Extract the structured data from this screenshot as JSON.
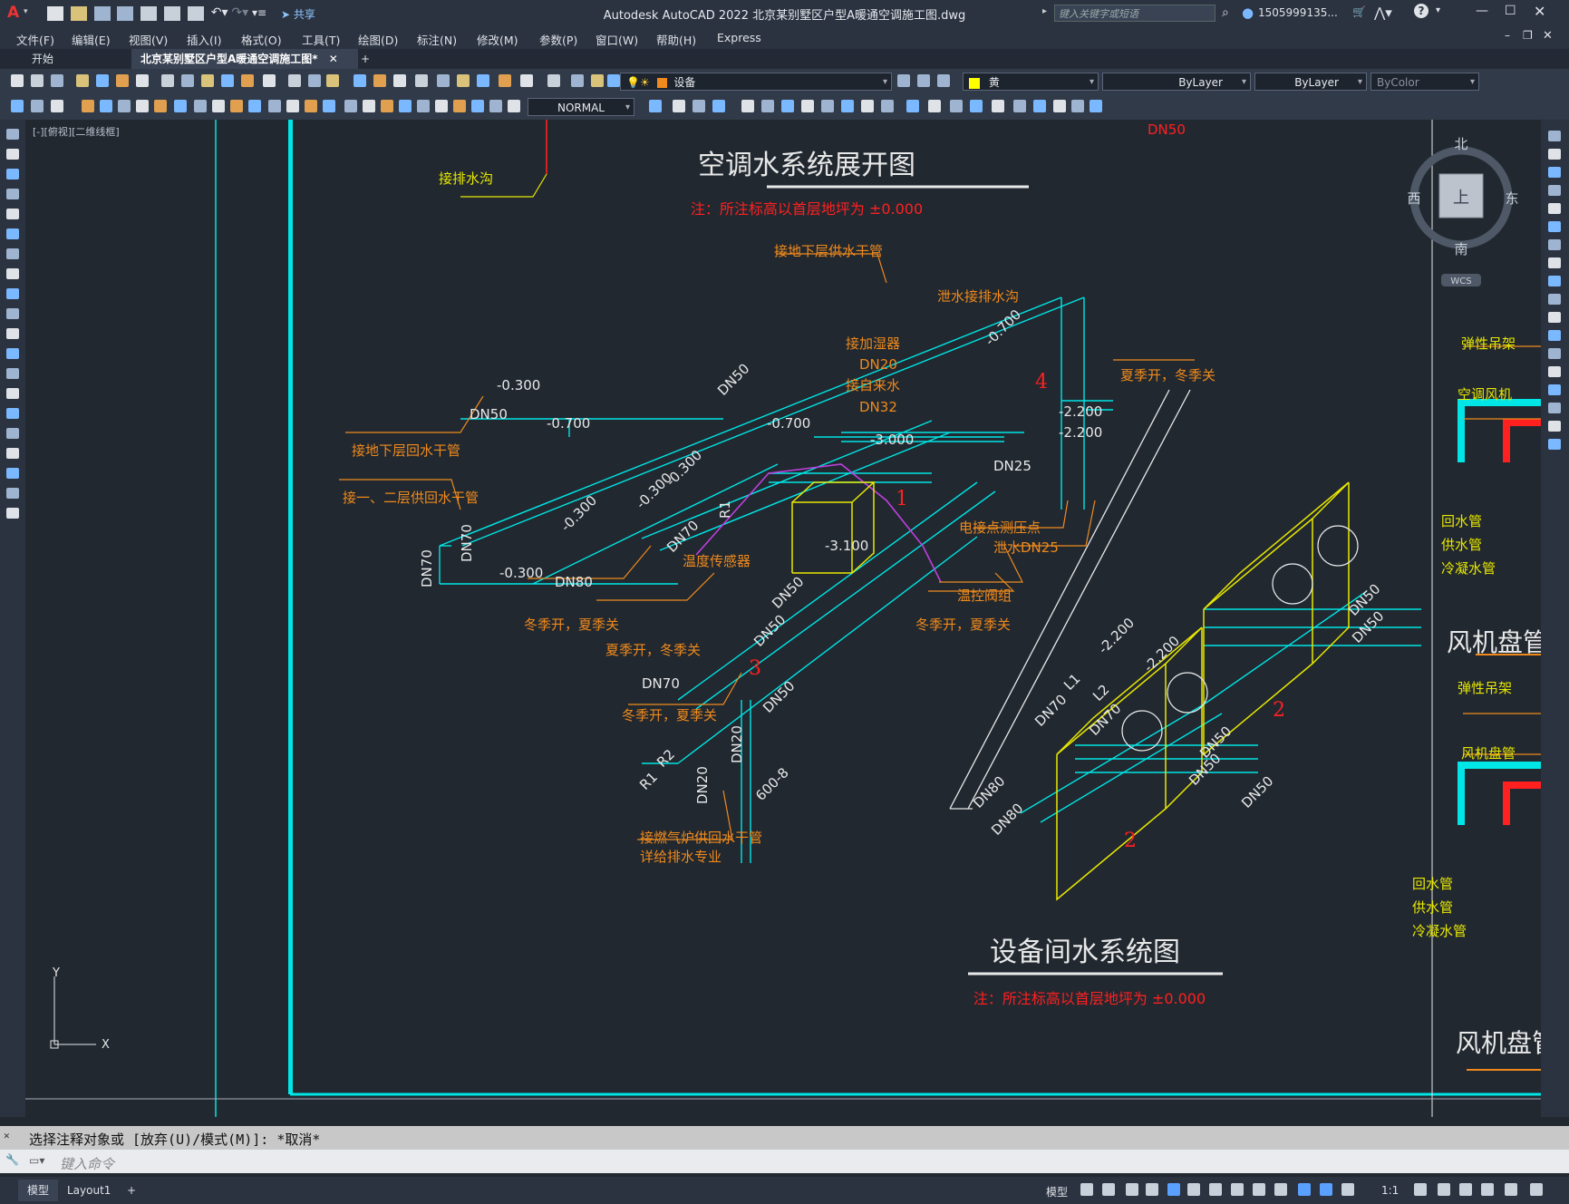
{
  "window": {
    "title": "Autodesk AutoCAD 2022    北京某别墅区户型A暖通空调施工图.dwg",
    "share_label": "共享",
    "search_placeholder": "键入关键字或短语",
    "user": "1505999135...",
    "help_label": "?"
  },
  "menu": [
    "文件(F)",
    "编辑(E)",
    "视图(V)",
    "插入(I)",
    "格式(O)",
    "工具(T)",
    "绘图(D)",
    "标注(N)",
    "修改(M)",
    "参数(P)",
    "窗口(W)",
    "帮助(H)",
    "Express"
  ],
  "tabs": {
    "start": "开始",
    "doc": "北京某别墅区户型A暖通空调施工图*",
    "add": "+"
  },
  "toolbar": {
    "layer": "设备",
    "color": "黄",
    "linetype": "ByLayer",
    "lineweight": "ByLayer",
    "plotstyle": "ByColor",
    "textstyle": "NORMAL"
  },
  "viewport": {
    "label": "[-][俯视][二维线框]",
    "viewcube": {
      "north": "北",
      "south": "南",
      "east": "东",
      "west": "西",
      "face": "上",
      "wcs": "WCS"
    },
    "ucs": {
      "x": "X",
      "y": "Y"
    }
  },
  "drawing": {
    "title1": "空调水系统展开图",
    "note1": "注：所注标高以首层地坪为 ±0.000",
    "title2": "设备间水系统图",
    "note2": "注：所注标高以首层地坪为 ±0.000",
    "right_title1": "风机盘管",
    "right_title2": "风机盘管",
    "labels_orange": [
      "接地下层供水干管",
      "泄水接排水沟",
      "接加湿器",
      "DN20",
      "接自来水",
      "DN32",
      "夏季开，冬季关",
      "接地下层回水干管",
      "接一、二层供回水干管",
      "温度传感器",
      "冬季开，夏季关",
      "夏季开，冬季关",
      "电接点测压点",
      "泄水DN25",
      "温控阀组",
      "冬季开，夏季关",
      "冬季开，夏季关",
      "接燃气炉供回水干管",
      "详给排水专业"
    ],
    "labels_yellow": [
      "接排水沟",
      "弹性吊架",
      "空调风机",
      "回水管",
      "供水管",
      "冷凝水管",
      "弹性吊架",
      "风机盘管",
      "回水管",
      "供水管",
      "冷凝水管"
    ],
    "labels_white": [
      "-0.300",
      "DN50",
      "-0.700",
      "-0.700",
      "-0.300",
      "-0.300",
      "-0.300",
      "DN70",
      "DN70",
      "DN80",
      "DN50",
      "-0.300",
      "DN70",
      "R1",
      "-3.000",
      "-0.700",
      "-2.200",
      "-2.200",
      "DN25",
      "-3.100",
      "DN50",
      "DN50",
      "DN70",
      "DN50",
      "R2",
      "R1",
      "DN20",
      "DN20",
      "600-8",
      "-2.200",
      "-2.200",
      "L1",
      "L2",
      "DN70",
      "DN70",
      "DN80",
      "DN80",
      "DN50",
      "DN50",
      "DN50",
      "DN50",
      "DN50"
    ],
    "labels_red": [
      "1",
      "2",
      "3",
      "4",
      "2",
      "DN50"
    ]
  },
  "command": {
    "history": "选择注释对象或 [放弃(U)/模式(M)]: *取消*",
    "prompt_placeholder": "键入命令"
  },
  "status": {
    "model": "模型",
    "layout1": "Layout1",
    "add": "+",
    "model_btn": "模型",
    "scale": "1:1"
  },
  "colors": {
    "cyan": "#00e5e5",
    "yellow": "#e8e800",
    "orange": "#f08a1c",
    "red": "#ff2020",
    "magenta": "#c040e0",
    "white": "#e8e8e8",
    "bg": "#212830"
  }
}
